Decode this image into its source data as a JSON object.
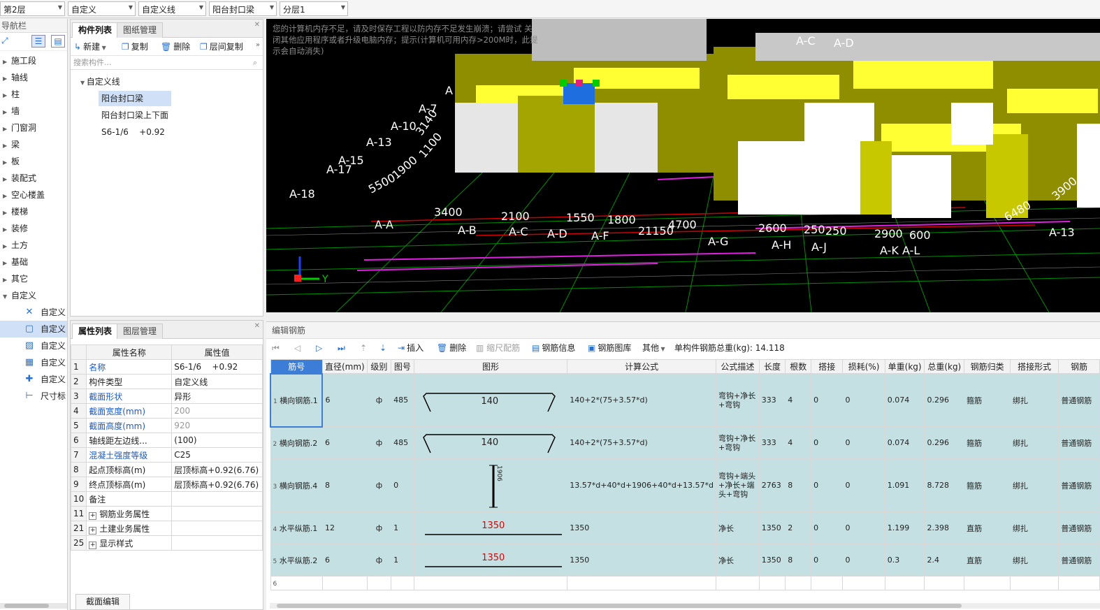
{
  "topbar": {
    "floor": "第2层",
    "type": "自定义",
    "subtype": "自定义线",
    "component": "阳台封口梁",
    "layer": "分层1"
  },
  "nav": {
    "title": "导航栏",
    "items": [
      "施工段",
      "轴线",
      "柱",
      "墙",
      "门窗洞",
      "梁",
      "板",
      "装配式",
      "空心楼盖",
      "楼梯",
      "装修",
      "土方",
      "基础",
      "其它",
      "自定义"
    ],
    "subitems": [
      "自定义",
      "自定义",
      "自定义",
      "自定义",
      "自定义",
      "尺寸标"
    ]
  },
  "component_panel": {
    "tab_list": "构件列表",
    "tab_drawings": "图纸管理",
    "btn_new": "新建",
    "btn_copy": "复制",
    "btn_delete": "删除",
    "btn_floor_copy": "层间复制",
    "search_placeholder": "搜索构件...",
    "tree_root": "自定义线",
    "tree_items": [
      "阳台封口梁",
      "阳台封口梁上下面",
      "S6-1/6    +0.92"
    ]
  },
  "property_panel": {
    "tab_props": "属性列表",
    "tab_layers": "图层管理",
    "col_name": "属性名称",
    "col_value": "属性值",
    "rows": [
      {
        "n": "1",
        "name": "名称",
        "value": "S6-1/6    +0.92"
      },
      {
        "n": "2",
        "name": "构件类型",
        "value": "自定义线"
      },
      {
        "n": "3",
        "name": "截面形状",
        "value": "异形"
      },
      {
        "n": "4",
        "name": "截面宽度(mm)",
        "value": "200"
      },
      {
        "n": "5",
        "name": "截面高度(mm)",
        "value": "920"
      },
      {
        "n": "6",
        "name": "轴线距左边线...",
        "value": "(100)"
      },
      {
        "n": "7",
        "name": "混凝土强度等级",
        "value": "C25"
      },
      {
        "n": "8",
        "name": "起点顶标高(m)",
        "value": "层顶标高+0.92(6.76)"
      },
      {
        "n": "9",
        "name": "终点顶标高(m)",
        "value": "层顶标高+0.92(6.76)"
      },
      {
        "n": "10",
        "name": "备注",
        "value": ""
      },
      {
        "n": "11",
        "name": "钢筋业务属性",
        "value": ""
      },
      {
        "n": "21",
        "name": "土建业务属性",
        "value": ""
      },
      {
        "n": "25",
        "name": "显示样式",
        "value": ""
      }
    ],
    "bottom_tab": "截面编辑"
  },
  "viewport": {
    "warning": "您的计算机内存不足，请及时保存工程以防内存不足发生崩溃；请尝试 关闭其他应用程序或者升级电脑内存；提示(计算机可用内存>200M时，此提示会自动消失)",
    "axis_labels": [
      "A-C",
      "A-D",
      "A-7",
      "A-10",
      "A-13",
      "A-15",
      "A-17",
      "A-18",
      "A-A",
      "A-B",
      "A-C",
      "A-D",
      "A-F",
      "A-G",
      "A-H",
      "A-J",
      "A-K",
      "A-L",
      "A-13",
      "A"
    ],
    "dims": [
      "3400",
      "2100",
      "1550",
      "1800",
      "21150",
      "4700",
      "2600",
      "250",
      "250",
      "2900",
      "600",
      "6480",
      "5500",
      "1900",
      "1100",
      "3140",
      "3900"
    ],
    "axis_y": "Y"
  },
  "rebar_editor": {
    "title": "编辑钢筋",
    "btn_insert": "插入",
    "btn_delete": "删除",
    "btn_scale": "缩尺配筋",
    "btn_info": "钢筋信息",
    "btn_library": "钢筋图库",
    "btn_other": "其他",
    "total_label": "单构件钢筋总重(kg): 14.118",
    "headers": [
      "筋号",
      "直径(mm)",
      "级别",
      "图号",
      "图形",
      "计算公式",
      "公式描述",
      "长度",
      "根数",
      "搭接",
      "损耗(%)",
      "单重(kg)",
      "总重(kg)",
      "钢筋归类",
      "搭接形式",
      "钢筋"
    ],
    "rows": [
      {
        "n": "1",
        "name": "横向钢筋.1",
        "dia": "6",
        "grade": "ф",
        "fig": "485",
        "shape": "140",
        "formula": "140+2*(75+3.57*d)",
        "desc": "弯钩+净长+弯钩",
        "len": "333",
        "count": "4",
        "lap": "0",
        "loss": "0",
        "unit": "0.074",
        "total": "0.296",
        "cat": "箍筋",
        "laptype": "绑扎",
        "type": "普通钢筋"
      },
      {
        "n": "2",
        "name": "横向钢筋.2",
        "dia": "6",
        "grade": "ф",
        "fig": "485",
        "shape": "140",
        "formula": "140+2*(75+3.57*d)",
        "desc": "弯钩+净长+弯钩",
        "len": "333",
        "count": "4",
        "lap": "0",
        "loss": "0",
        "unit": "0.074",
        "total": "0.296",
        "cat": "箍筋",
        "laptype": "绑扎",
        "type": "普通钢筋"
      },
      {
        "n": "3",
        "name": "横向钢筋.4",
        "dia": "8",
        "grade": "ф",
        "fig": "0",
        "shape": "1906",
        "formula": "13.57*d+40*d+1906+40*d+13.57*d",
        "desc": "弯钩+端头+净长+端头+弯钩",
        "len": "2763",
        "count": "8",
        "lap": "0",
        "loss": "0",
        "unit": "1.091",
        "total": "8.728",
        "cat": "箍筋",
        "laptype": "绑扎",
        "type": "普通钢筋"
      },
      {
        "n": "4",
        "name": "水平纵筋.1",
        "dia": "12",
        "grade": "ф",
        "fig": "1",
        "shape": "1350",
        "formula": "1350",
        "desc": "净长",
        "len": "1350",
        "count": "2",
        "lap": "0",
        "loss": "0",
        "unit": "1.199",
        "total": "2.398",
        "cat": "直筋",
        "laptype": "绑扎",
        "type": "普通钢筋"
      },
      {
        "n": "5",
        "name": "水平纵筋.2",
        "dia": "6",
        "grade": "ф",
        "fig": "1",
        "shape": "1350",
        "formula": "1350",
        "desc": "净长",
        "len": "1350",
        "count": "8",
        "lap": "0",
        "loss": "0",
        "unit": "0.3",
        "total": "2.4",
        "cat": "直筋",
        "laptype": "绑扎",
        "type": "普通钢筋"
      }
    ],
    "empty_row": "6"
  },
  "colors": {
    "selection": "#cfe0f7",
    "row_bg": "#c5e0e3",
    "accent": "#2a6fc9",
    "cad_yellow": "#c8c800",
    "cad_green": "#00cc00",
    "cad_magenta": "#e020e0"
  }
}
